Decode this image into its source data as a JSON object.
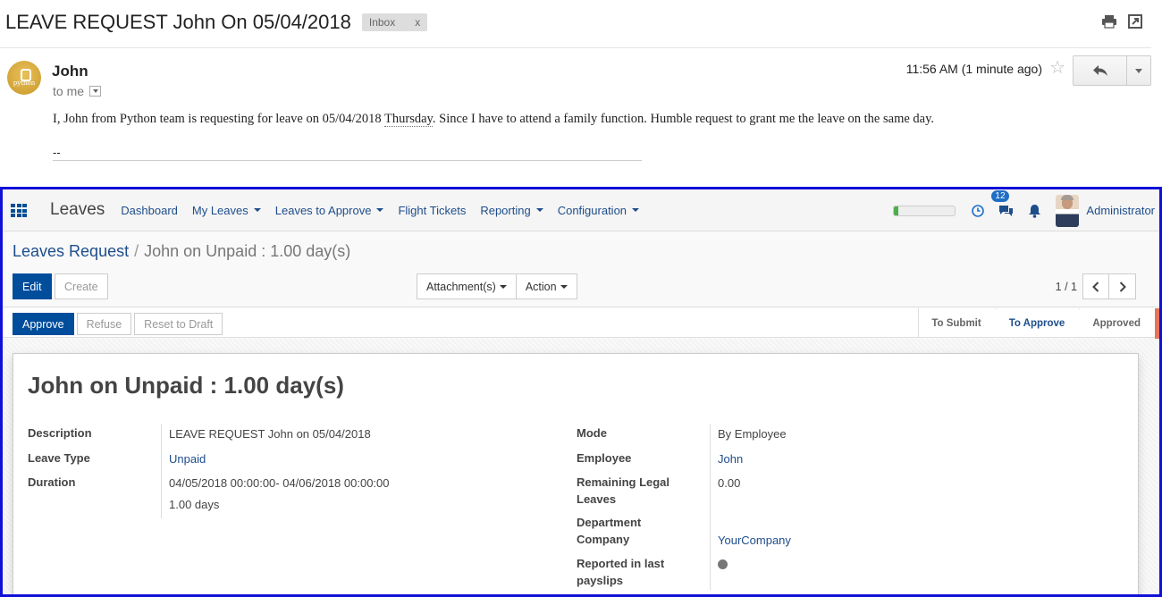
{
  "email": {
    "subject": "LEAVE REQUEST John On 05/04/2018",
    "label_badge": "Inbox",
    "label_close": "x",
    "avatar_text": "python",
    "sender": "John",
    "recipient": "to me",
    "time": "11:56 AM (1 minute ago)",
    "body_start": "I, John from  Python team is requesting for leave on 05/04/2018 ",
    "body_day": "Thursday",
    "body_end": ". Since  I have to attend a family function. Humble request to grant me the leave on the same day.",
    "signature": "--",
    "icons": [
      "print-icon",
      "popout-icon",
      "star-icon",
      "reply-icon"
    ]
  },
  "navbar": {
    "app_name": "Leaves",
    "menu": [
      {
        "label": "Dashboard",
        "dropdown": false
      },
      {
        "label": "My Leaves",
        "dropdown": true
      },
      {
        "label": "Leaves to Approve",
        "dropdown": true
      },
      {
        "label": "Flight Tickets",
        "dropdown": false
      },
      {
        "label": "Reporting",
        "dropdown": true
      },
      {
        "label": "Configuration",
        "dropdown": true
      }
    ],
    "progress_fraction": 0.06,
    "messages_count": "12",
    "user_name": "Administrator",
    "accent_color": "#004d9c"
  },
  "control_panel": {
    "breadcrumb_parent": "Leaves Request",
    "breadcrumb_separator": "/",
    "breadcrumb_current": "John on Unpaid : 1.00 day(s)",
    "edit_label": "Edit",
    "create_label": "Create",
    "attachments_label": "Attachment(s)",
    "action_label": "Action",
    "pager": "1 / 1"
  },
  "status": {
    "approve_label": "Approve",
    "refuse_label": "Refuse",
    "reset_label": "Reset to Draft",
    "stages": [
      "To Submit",
      "To Approve",
      "Approved"
    ],
    "active_stage": "To Approve"
  },
  "form": {
    "title": "John on Unpaid : 1.00 day(s)",
    "left": {
      "description_label": "Description",
      "description_value": "LEAVE REQUEST John on 05/04/2018",
      "leave_type_label": "Leave Type",
      "leave_type_value": "Unpaid",
      "duration_label": "Duration",
      "duration_range": "04/05/2018 00:00:00- 04/06/2018 00:00:00",
      "duration_days": "1.00 days"
    },
    "right": {
      "mode_label": "Mode",
      "mode_value": "By Employee",
      "employee_label": "Employee",
      "employee_value": "John",
      "remaining_label_1": "Remaining Legal",
      "remaining_label_2": "Leaves",
      "remaining_value": "0.00",
      "department_label": "Department",
      "company_label": "Company",
      "company_value": "YourCompany",
      "reported_label_1": "Reported in last",
      "reported_label_2": "payslips"
    }
  }
}
